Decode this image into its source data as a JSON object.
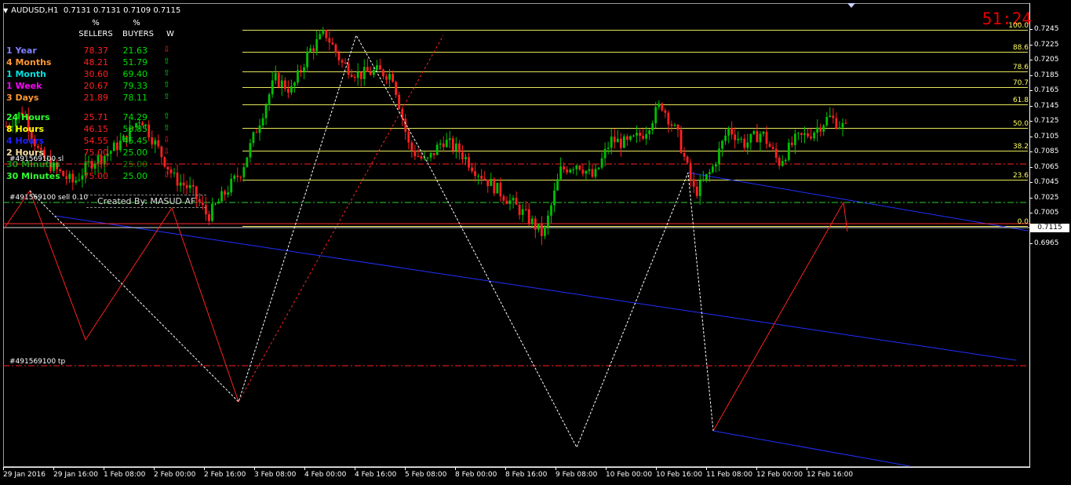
{
  "header": {
    "symbol": "AUDUSD,H1",
    "ohlc": "0.7131 0.7131 0.7109 0.7115"
  },
  "timer": "51:24",
  "stats": {
    "sellers_pct": "%",
    "sellers": "SELLERS",
    "buyers_pct": "%",
    "buyers": "BUYERS",
    "w": "W",
    "rows": [
      {
        "name": "1 Year",
        "sellers": "78.37",
        "buyers": "21.63",
        "dir": "down",
        "color": "#8080ff"
      },
      {
        "name": "4 Months",
        "sellers": "48.21",
        "buyers": "51.79",
        "dir": "up",
        "color": "#ff9933"
      },
      {
        "name": "1 Month",
        "sellers": "30.60",
        "buyers": "69.40",
        "dir": "up",
        "color": "#00e0e0"
      },
      {
        "name": "1 Week",
        "sellers": "20.67",
        "buyers": "79.33",
        "dir": "up",
        "color": "#ff00ff"
      },
      {
        "name": "3 Days",
        "sellers": "21.89",
        "buyers": "78.11",
        "dir": "up",
        "color": "#ff9933"
      },
      {
        "name": "24 Hours",
        "sellers": "25.71",
        "buyers": "74.29",
        "dir": "up",
        "color": "#30ff30"
      },
      {
        "name": "8 Hours",
        "sellers": "46.15",
        "buyers": "53.85",
        "dir": "up",
        "color": "#ffff00"
      },
      {
        "name": "4 Hours",
        "sellers": "54.55",
        "buyers": "45.45",
        "dir": "down",
        "color": "#2020ff"
      },
      {
        "name": "2 Hours",
        "sellers": "75.00",
        "buyers": "25.00",
        "dir": "down",
        "color": "#ffe0a0"
      },
      {
        "name": "30 Minutes",
        "sellers": "75.00",
        "buyers": "25.00",
        "dir": "down",
        "color": "#30ff30"
      },
      {
        "name": "30 Minutes",
        "sellers": "75.00",
        "buyers": "25.00",
        "dir": "down",
        "color": "#30ff30"
      }
    ]
  },
  "created_by": "Created By: MASUD AF",
  "orders": {
    "sl": "#491569100 sl",
    "sell": "#491569100 sell 0.10",
    "tp": "#491569100 tp"
  },
  "fib_levels": [
    "100.0",
    "88.6",
    "78.6",
    "70.7",
    "61.8",
    "50.0",
    "38.2",
    "23.6",
    "0.0"
  ],
  "current_price": "0.7115",
  "chart_data": {
    "type": "candlestick",
    "symbol": "AUDUSD",
    "timeframe": "H1",
    "y_ticks": [
      "0.7245",
      "0.7225",
      "0.7205",
      "0.7185",
      "0.7165",
      "0.7145",
      "0.7125",
      "0.7105",
      "0.7085",
      "0.7065",
      "0.7045",
      "0.7025",
      "0.7005",
      "0.6985",
      "0.6965"
    ],
    "x_ticks": [
      "29 Jan 2016",
      "29 Jan 16:00",
      "1 Feb 08:00",
      "2 Feb 00:00",
      "2 Feb 16:00",
      "3 Feb 08:00",
      "4 Feb 00:00",
      "4 Feb 16:00",
      "5 Feb 08:00",
      "8 Feb 00:00",
      "8 Feb 16:00",
      "9 Feb 08:00",
      "10 Feb 00:00",
      "10 Feb 16:00",
      "11 Feb 08:00",
      "12 Feb 00:00",
      "12 Feb 16:00"
    ],
    "ylim": [
      0.6958,
      0.7253
    ],
    "price_path": [
      0.7118,
      0.7138,
      0.708,
      0.706,
      0.7044,
      0.707,
      0.7082,
      0.71,
      0.713,
      0.709,
      0.705,
      0.7035,
      0.7,
      0.703,
      0.706,
      0.712,
      0.718,
      0.7165,
      0.7215,
      0.724,
      0.72,
      0.7185,
      0.719,
      0.7185,
      0.709,
      0.707,
      0.71,
      0.7085,
      0.706,
      0.704,
      0.702,
      0.7,
      0.6975,
      0.706,
      0.707,
      0.705,
      0.71,
      0.7095,
      0.711,
      0.7148,
      0.7105,
      0.703,
      0.706,
      0.7115,
      0.7095,
      0.711,
      0.707,
      0.71,
      0.711,
      0.713,
      0.7115
    ],
    "fib_anchor": {
      "high": 0.7244,
      "low": 0.6988
    }
  }
}
